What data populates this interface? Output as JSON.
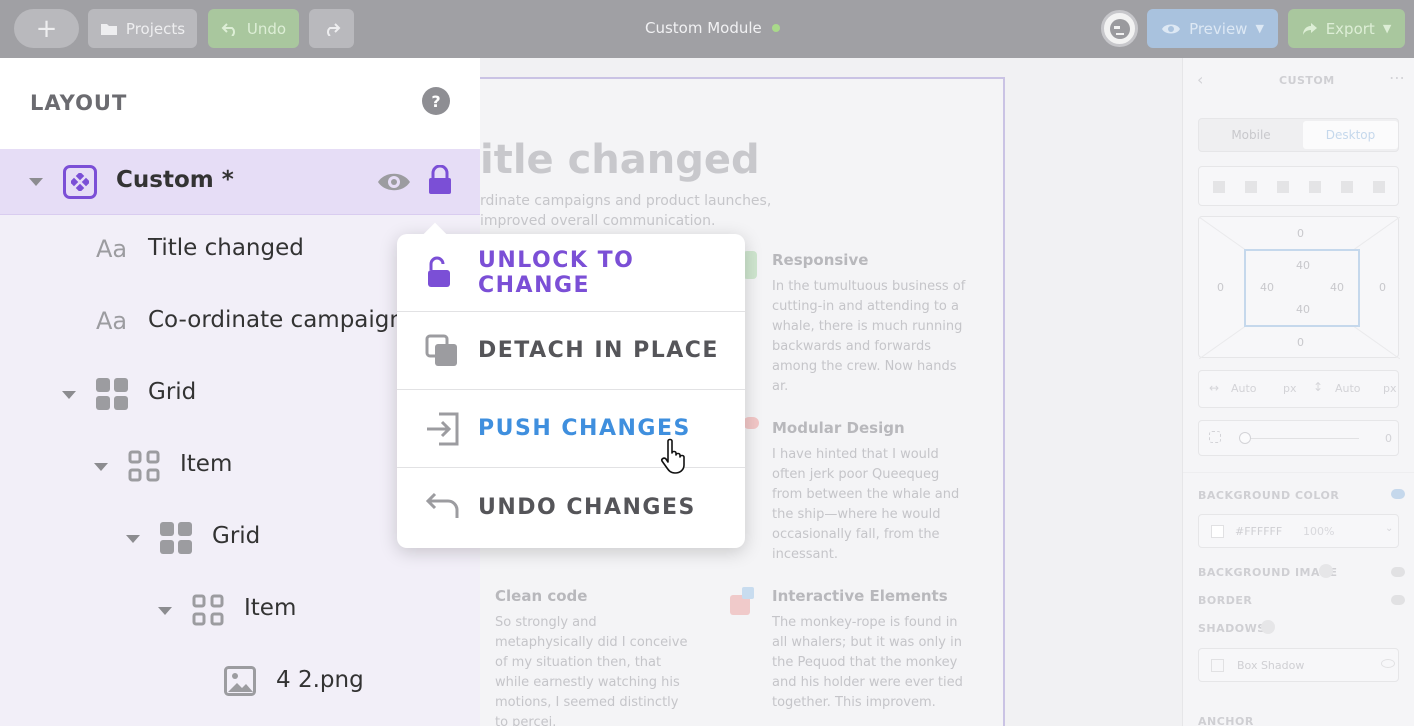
{
  "topbar": {
    "add_label": "+",
    "projects_label": "Projects",
    "undo_label": "Undo",
    "title": "Custom Module",
    "preview_label": "Preview",
    "export_label": "Export"
  },
  "layout": {
    "title": "LAYOUT",
    "help": "?",
    "tree": [
      {
        "label": "Custom *",
        "icon": "component-icon"
      },
      {
        "label": "Title changed",
        "icon": "text-icon"
      },
      {
        "label": "Co-ordinate campaigns",
        "icon": "text-icon"
      },
      {
        "label": "Grid",
        "icon": "grid-icon"
      },
      {
        "label": "Item",
        "icon": "grid-icon"
      },
      {
        "label": "Grid",
        "icon": "grid-icon"
      },
      {
        "label": "Item",
        "icon": "grid-icon"
      },
      {
        "label": "4 2.png",
        "icon": "image-icon"
      }
    ]
  },
  "context_menu": {
    "items": [
      {
        "label": "UNLOCK TO CHANGE",
        "color": "#7b4fd6",
        "icon": "unlock-icon"
      },
      {
        "label": "DETACH IN PLACE",
        "color": "#555559",
        "icon": "detach-icon"
      },
      {
        "label": "PUSH CHANGES",
        "color": "#3f8fde",
        "icon": "push-icon"
      },
      {
        "label": "UNDO CHANGES",
        "color": "#555559",
        "icon": "undo-icon"
      }
    ]
  },
  "canvas": {
    "title": "itle changed",
    "subtitle_line1": "rdinate campaigns and product launches,",
    "subtitle_line2": "improved overall communication.",
    "features": [
      {
        "title": "Responsive",
        "body": "In the tumultuous business of cutting-in and attending to a whale, there is much running backwards and forwards among the crew. Now hands ar."
      },
      {
        "title": "Modular Design",
        "body": "I have hinted that I would often jerk poor Queequeg from between the whale and the ship—where he would occasionally fall, from the incessant."
      },
      {
        "title": "Clean code",
        "body": "So strongly and metaphysically did I conceive of my situation then, that while earnestly watching his motions, I seemed distinctly to percei."
      },
      {
        "title": "Interactive Elements",
        "body": "The monkey-rope is found in all whalers; but it was only in the Pequod that the monkey and his holder were ever tied together. This improvem."
      }
    ]
  },
  "right_panel": {
    "title": "CUSTOM",
    "tab_mobile": "Mobile",
    "tab_desktop": "Desktop",
    "spacing": {
      "outer_top": "0",
      "outer_left": "0",
      "outer_right": "0",
      "outer_bottom": "0",
      "inner_top": "40",
      "inner_left": "40",
      "inner_right": "40",
      "inner_bottom": "40"
    },
    "width_value": "Auto",
    "width_unit": "px",
    "height_value": "Auto",
    "height_unit": "px",
    "radius_value": "0",
    "bg_color_label": "BACKGROUND COLOR",
    "bg_color_value": "#FFFFFF",
    "bg_opacity": "100%",
    "bg_image_label": "BACKGROUND IMAGE",
    "border_label": "BORDER",
    "shadows_label": "SHADOWS",
    "box_shadow_label": "Box Shadow",
    "anchor_label": "ANCHOR"
  }
}
